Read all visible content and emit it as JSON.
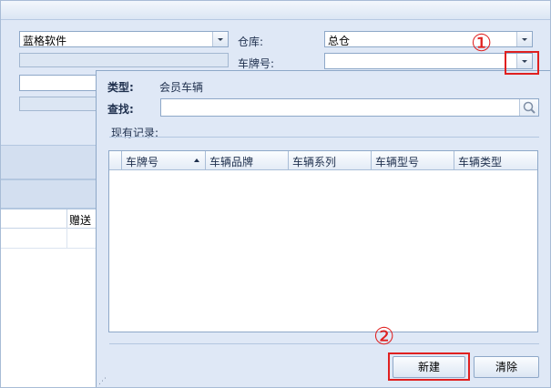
{
  "top_form": {
    "company_value": "蓝格软件",
    "warehouse_label": "仓库:",
    "warehouse_value": "总仓",
    "plate_label": "车牌号:",
    "plate_value": ""
  },
  "background_table": {
    "gift_column": "赠送"
  },
  "popup": {
    "type_label": "类型:",
    "type_value": "会员车辆",
    "search_label": "查找:",
    "search_value": "",
    "records_label": "现有记录:",
    "columns": [
      "车牌号",
      "车辆品牌",
      "车辆系列",
      "车辆型号",
      "车辆类型"
    ],
    "new_button": "新建",
    "clear_button": "清除"
  },
  "annotations": {
    "marker_1": "①",
    "marker_2": "②",
    "highlight_color": "#e02020"
  }
}
